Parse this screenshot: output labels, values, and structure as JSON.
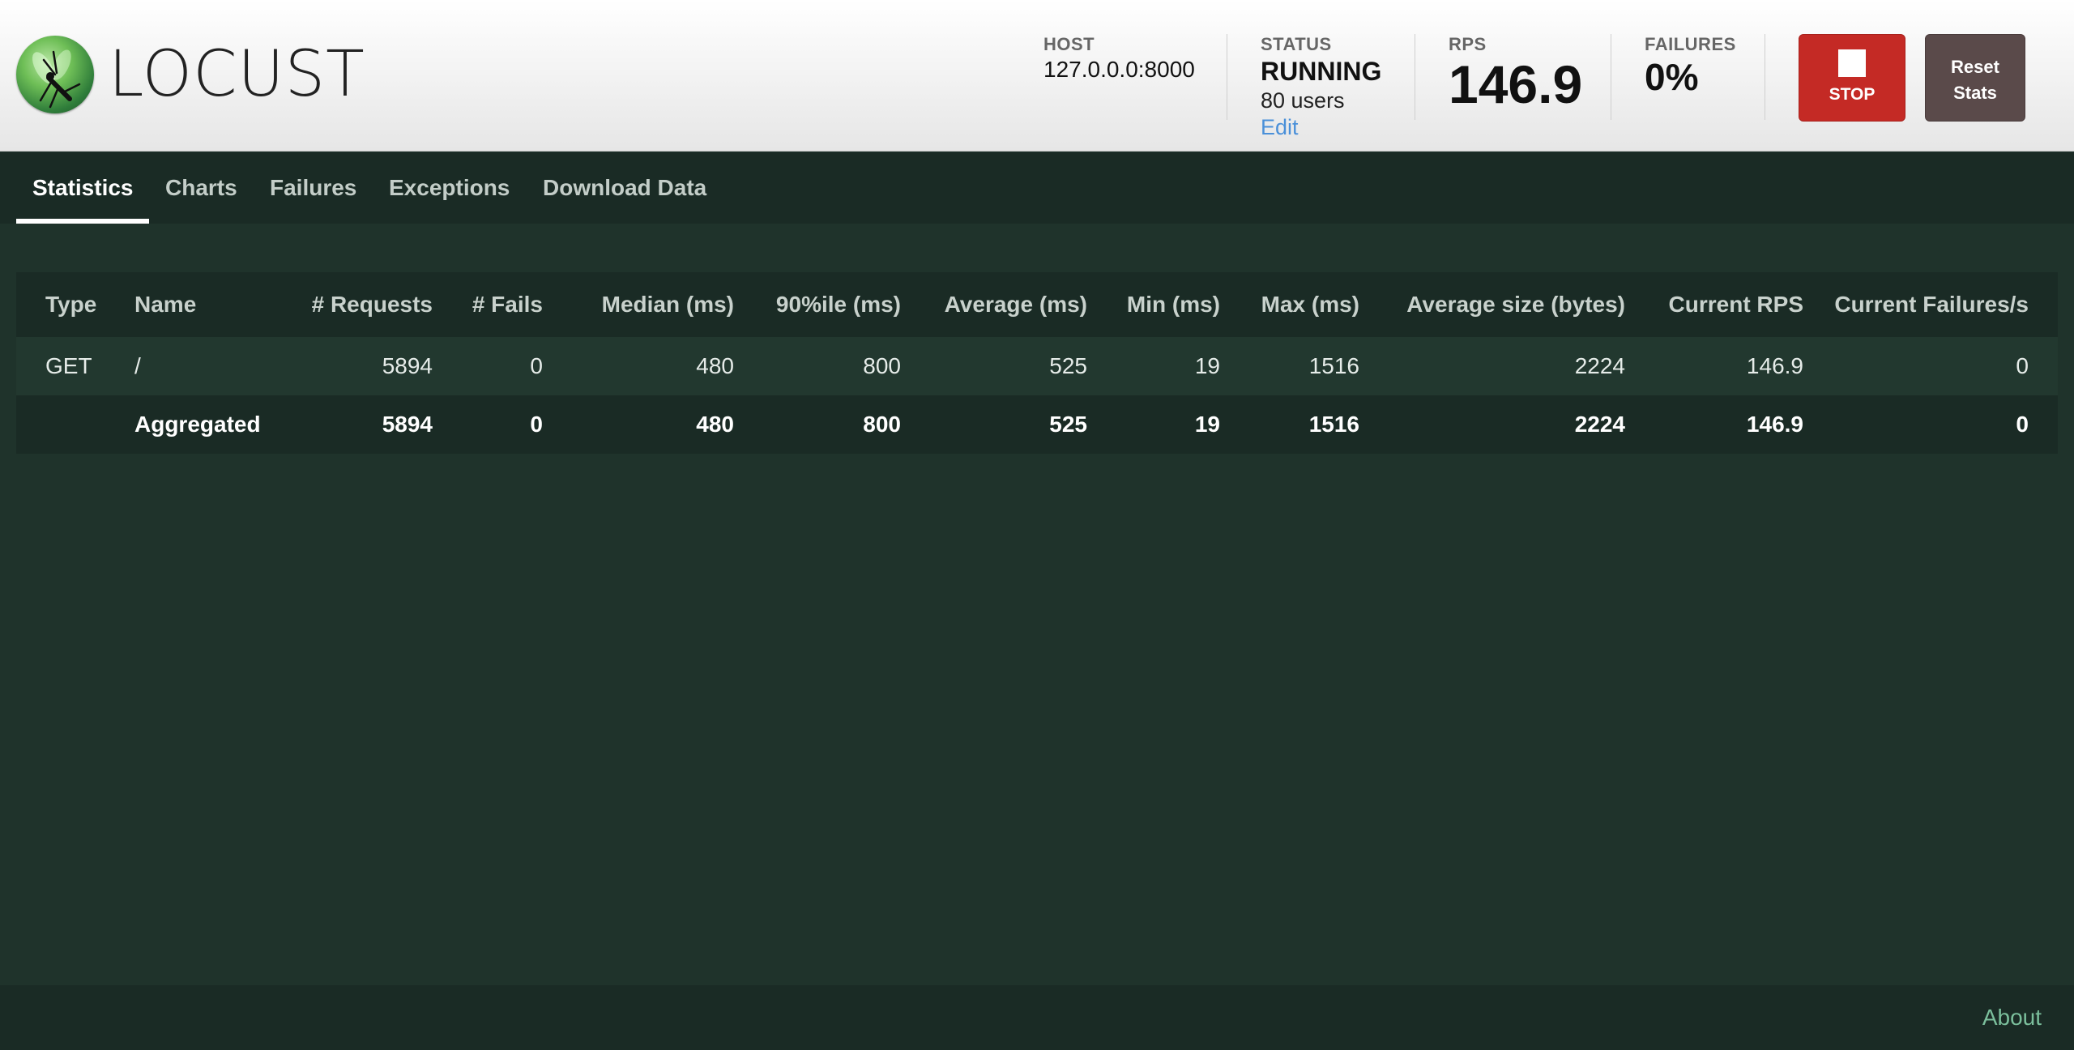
{
  "app": {
    "logo_text": "LOCUST"
  },
  "header": {
    "host_label": "HOST",
    "host_value": "127.0.0.0:8000",
    "status_label": "STATUS",
    "status_value": "RUNNING",
    "users_value": "80 users",
    "edit_label": "Edit",
    "rps_label": "RPS",
    "rps_value": "146.9",
    "failures_label": "FAILURES",
    "failures_value": "0%",
    "stop_label": "STOP",
    "reset_line1": "Reset",
    "reset_line2": "Stats"
  },
  "tabs": [
    {
      "label": "Statistics",
      "active": true
    },
    {
      "label": "Charts"
    },
    {
      "label": "Failures"
    },
    {
      "label": "Exceptions"
    },
    {
      "label": "Download Data"
    }
  ],
  "table": {
    "columns": [
      "Type",
      "Name",
      "# Requests",
      "# Fails",
      "Median (ms)",
      "90%ile (ms)",
      "Average (ms)",
      "Min (ms)",
      "Max (ms)",
      "Average size (bytes)",
      "Current RPS",
      "Current Failures/s"
    ],
    "rows": [
      [
        "GET",
        "/",
        "5894",
        "0",
        "480",
        "800",
        "525",
        "19",
        "1516",
        "2224",
        "146.9",
        "0"
      ]
    ],
    "aggregated": [
      "",
      "Aggregated",
      "5894",
      "0",
      "480",
      "800",
      "525",
      "19",
      "1516",
      "2224",
      "146.9",
      "0"
    ]
  },
  "footer": {
    "about_label": "About"
  },
  "colors": {
    "background": "#1f332b",
    "stop_button": "#c42a25",
    "reset_button": "#5a4a4a",
    "link": "#4a90d9"
  }
}
